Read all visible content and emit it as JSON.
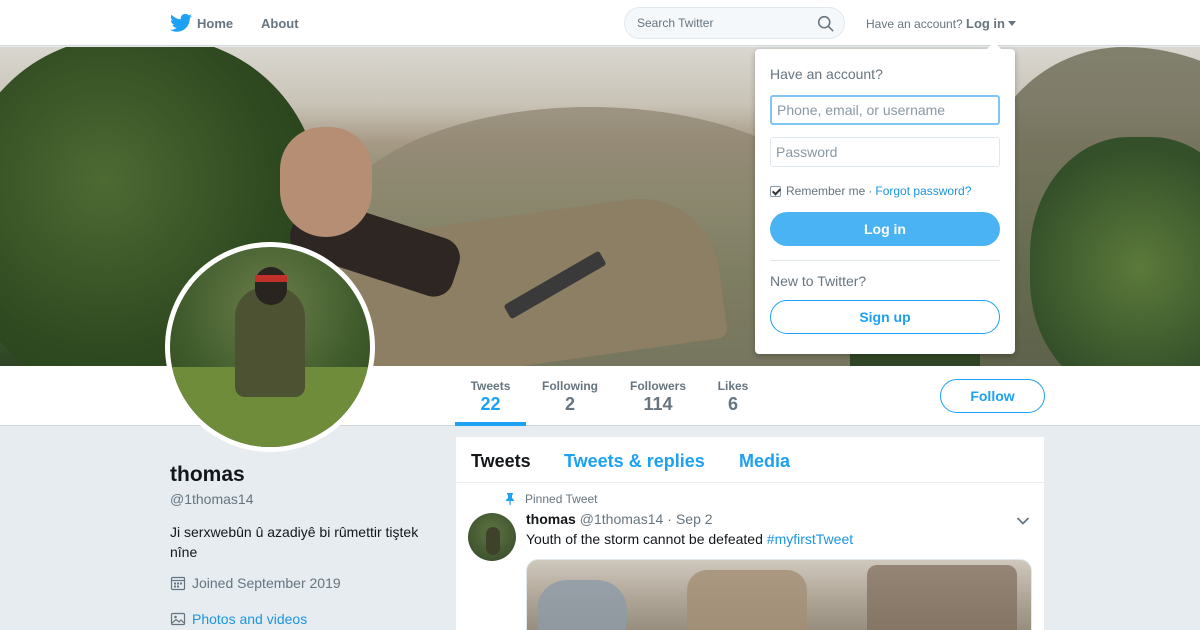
{
  "topbar": {
    "home_label": "Home",
    "about_label": "About",
    "search_placeholder": "Search Twitter",
    "have_account": "Have an account?",
    "login_label": "Log in"
  },
  "login_dropdown": {
    "title": "Have an account?",
    "username_placeholder": "Phone, email, or username",
    "password_placeholder": "Password",
    "remember_me": "Remember me",
    "separator": "·",
    "forgot_password": "Forgot password?",
    "login_button": "Log in",
    "new_to_twitter": "New to Twitter?",
    "signup_button": "Sign up"
  },
  "profile_nav": {
    "stats": [
      {
        "label": "Tweets",
        "value": "22"
      },
      {
        "label": "Following",
        "value": "2"
      },
      {
        "label": "Followers",
        "value": "114"
      },
      {
        "label": "Likes",
        "value": "6"
      }
    ],
    "follow_button": "Follow"
  },
  "profile": {
    "name": "thomas",
    "handle": "@1thomas14",
    "bio": "Ji serxwebûn û azadiyê bi rûmettir tiştek nîne",
    "joined": "Joined September 2019",
    "photos_link": "Photos and videos"
  },
  "timeline": {
    "tabs": [
      "Tweets",
      "Tweets & replies",
      "Media"
    ],
    "pinned_label": "Pinned Tweet",
    "tweet": {
      "name": "thomas",
      "handle": "@1thomas14",
      "dot": "·",
      "date": "Sep 2",
      "text": "Youth of the storm cannot be defeated",
      "hashtag": "#myfirstTweet"
    }
  },
  "colors": {
    "accent": "#1da1f2",
    "login_button": "#4ab3f4",
    "background": "#e6ecf0"
  }
}
